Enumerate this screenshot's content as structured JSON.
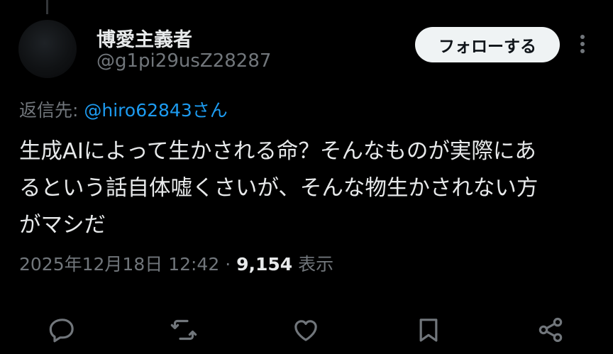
{
  "author": {
    "display_name": "博愛主義者",
    "handle": "@g1pi29usZ28287"
  },
  "follow_button_label": "フォローする",
  "reply_context": {
    "prefix": "返信先: ",
    "mention": "@hiro62843さん"
  },
  "tweet": {
    "lines": [
      "生成AIによって生かされる命？そんなものが実際にあ",
      "るという話自体嘘くさいが、そんな物生かされない方",
      "がマシだ"
    ]
  },
  "meta": {
    "timestamp": "2025年12月18日 12:42",
    "separator": " · ",
    "views_count": "9,154",
    "views_label": " 表示"
  },
  "icons": {
    "more": "more-vertical-icon",
    "reply": "reply-icon",
    "repost": "repost-icon",
    "like": "like-icon",
    "bookmark": "bookmark-icon",
    "share": "share-icon"
  },
  "colors": {
    "background": "#000000",
    "text": "#e7e9ea",
    "secondary": "#71767b",
    "link": "#1d9bf0",
    "button_bg": "#eff3f4",
    "button_text": "#0f1419"
  }
}
